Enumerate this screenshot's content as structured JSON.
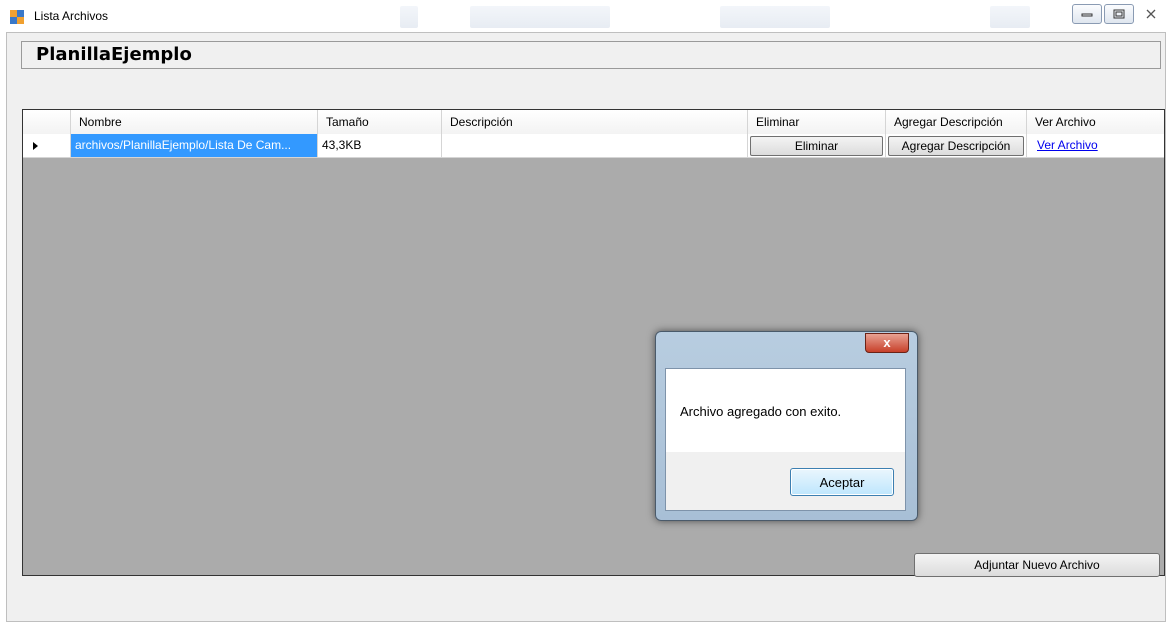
{
  "window": {
    "title": "Lista Archivos",
    "ghost_texts": [
      "Nombre Planilla",
      "Descripcion",
      "Adjuntar"
    ]
  },
  "page": {
    "title": "PlanillaEjemplo"
  },
  "grid": {
    "columns": [
      "Nombre",
      "Tamaño",
      "Descripción",
      "Eliminar",
      "Agregar Descripción",
      "Ver Archivo"
    ],
    "rows": [
      {
        "nombre": "archivos/PlanillaEjemplo/Lista De Cam...",
        "tamano": "43,3KB",
        "descripcion": "",
        "eliminar_label": "Eliminar",
        "agregar_label": "Agregar Descripción",
        "ver_label": "Ver Archivo"
      }
    ]
  },
  "dialog": {
    "close_glyph": "x",
    "message": "Archivo agregado con exito.",
    "ok_label": "Aceptar"
  },
  "footer": {
    "attach_label": "Adjuntar Nuevo Archivo"
  },
  "colors": {
    "grid_bg": "#ababab",
    "selection": "#3399ff",
    "link": "#0000ee"
  }
}
